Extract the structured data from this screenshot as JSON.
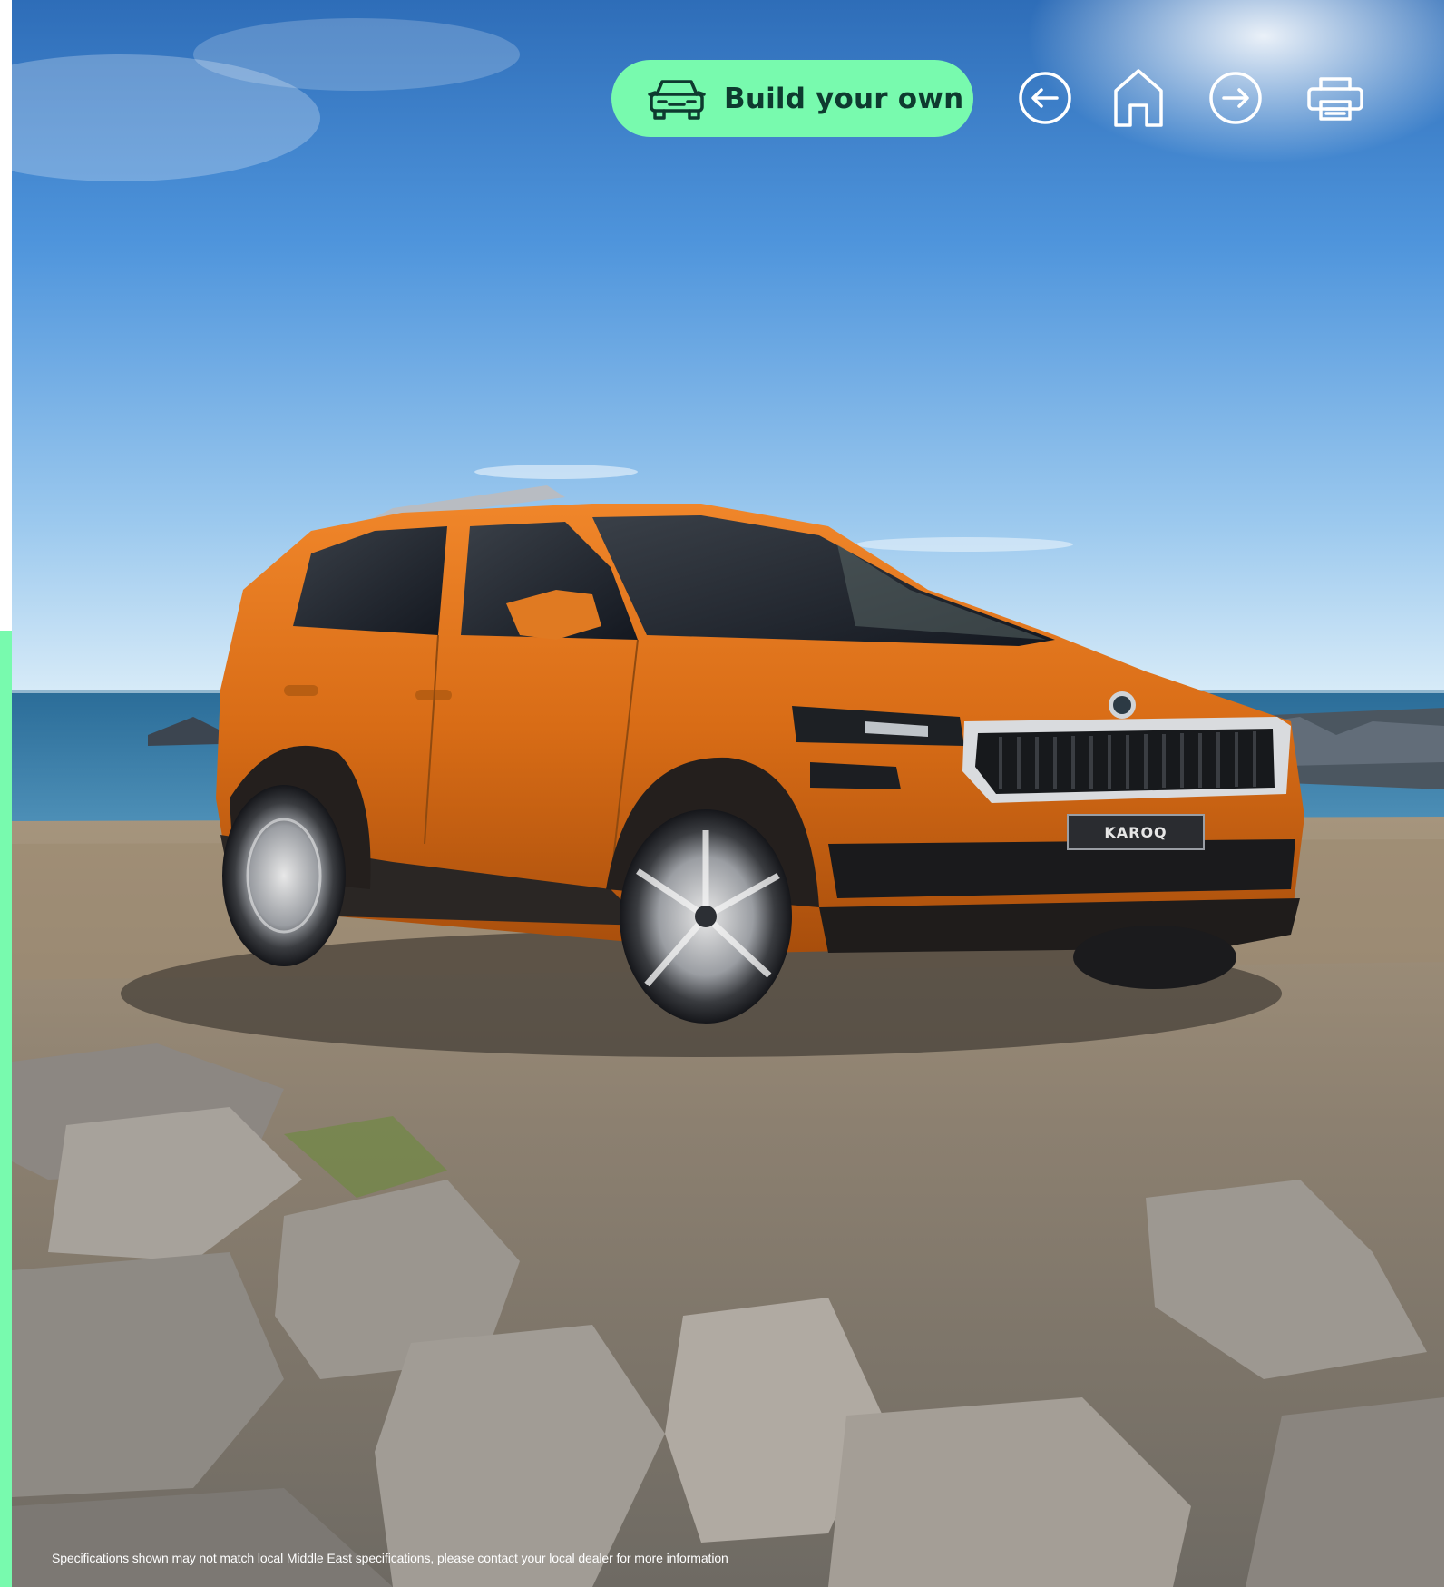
{
  "toolbar": {
    "build_label": "Build your own",
    "build_icon": "car-front-icon",
    "back_icon": "arrow-left-icon",
    "home_icon": "home-icon",
    "forward_icon": "arrow-right-icon",
    "print_icon": "printer-icon"
  },
  "hero": {
    "plate_text": "KAROQ",
    "subject": "orange-suv-on-rocky-shore"
  },
  "footer": {
    "disclaimer": "Specifications shown may not match local Middle East specifications, please contact your local dealer for more information"
  },
  "colors": {
    "accent": "#78faae",
    "accent_text": "#0e3a2f",
    "car_body": "#d86c16"
  }
}
